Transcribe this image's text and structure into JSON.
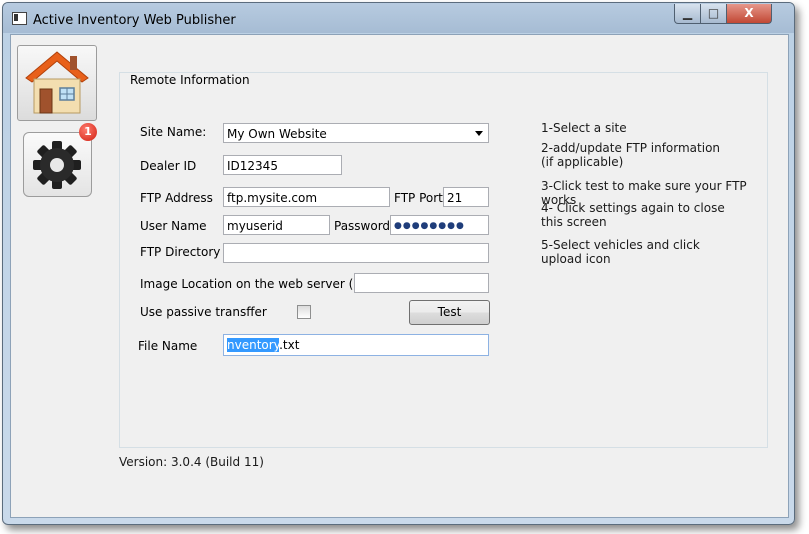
{
  "window": {
    "title": "Active Inventory Web Publisher",
    "controls": {
      "minimize": "▁",
      "maximize": "□",
      "close": "X"
    }
  },
  "sidebar": {
    "settings_badge": "1"
  },
  "remote": {
    "group_title": "Remote Information",
    "site_name_label": "Site Name:",
    "site_name_value": "My Own Website",
    "dealer_id_label": "Dealer ID",
    "dealer_id_value": "ID12345",
    "ftp_address_label": "FTP Address",
    "ftp_address_value": "ftp.mysite.com",
    "ftp_port_label": "FTP Port",
    "ftp_port_value": "21",
    "user_name_label": "User Name",
    "user_name_value": "myuserid",
    "password_label": "Password",
    "password_value": "●●●●●●●●",
    "ftp_directory_label": "FTP Directory",
    "ftp_directory_value": "",
    "image_location_label": "Image Location on the web server (dir)",
    "image_location_value": "",
    "passive_label": "Use passive transffer",
    "passive_checked": false,
    "test_button": "Test",
    "file_name_label": "File Name",
    "file_name_selected": "nventory",
    "file_name_rest": ".txt"
  },
  "instructions": [
    "1-Select a site",
    "2-add/update FTP information (if applicable)",
    "3-Click test to make sure your FTP works",
    "4- Click settings again to close this screen",
    "5-Select vehicles and click upload icon"
  ],
  "footer": {
    "version": "Version: 3.0.4 (Build 11)"
  },
  "colors": {
    "selection": "#3399ff",
    "badge": "#d01e10",
    "house_roof": "#e8601a",
    "house_wall": "#f3deb0"
  },
  "icons": {
    "home": "home-icon",
    "settings": "gear-icon"
  }
}
